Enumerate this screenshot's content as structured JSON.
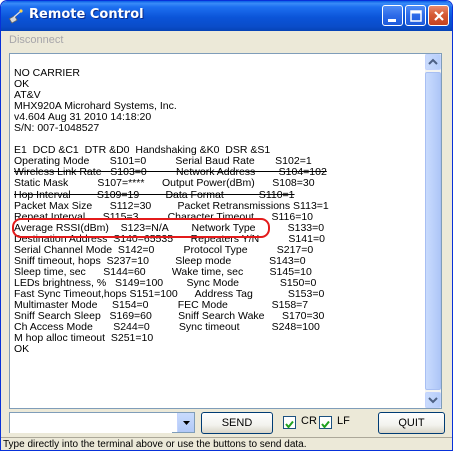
{
  "window": {
    "title": "Remote Control"
  },
  "menu": {
    "disconnect": "Disconnect"
  },
  "terminal": {
    "lines": [
      "NO CARRIER",
      "OK",
      "AT&V",
      "MHX920A Microhard Systems, Inc.",
      "v4.604 Aug 31 2010 14:18:20",
      "S/N: 007-1048527",
      "",
      "E1  DCD &C1  DTR &D0  Handshaking &K0  DSR &S1",
      "Operating Mode       S101=0          Serial Baud Rate       S102=1",
      "Wireless Link Rate   S103=0          Network Address        S104=102",
      "Static Mask          S107=****      Output Power(dBm)      S108=30",
      "Hop Interval         S109=19         Data Format            S110=1",
      "Packet Max Size      S112=30         Packet Retransmissions S113=1",
      "Repeat Interval      S115=3          Character Timeout      S116=10",
      "Average RSSI(dBm)    S123=N/A        Network Type           S133=0",
      "Destination Address  S140=65535      Repeaters Y/N          S141=0",
      "Serial Channel Mode  S142=0          Protocol Type          S217=0",
      "Sniff timeout, hops  S237=10         Sleep mode             S143=0",
      "Sleep time, sec      S144=60         Wake time, sec         S145=10",
      "LEDs brightness, %   S149=100        Sync Mode              S150=0",
      "Fast Sync Timeout,hops S151=100      Address Tag            S153=0",
      "Multimaster Mode     S154=0          FEC Mode               S158=7",
      "Sniff Search Sleep   S169=60         Sniff Search Wake      S170=30",
      "Ch Access Mode       S244=0          Sync timeout           S248=100",
      "M hop alloc timeout  S251=10",
      "OK"
    ]
  },
  "controls": {
    "command_value": "",
    "send_label": "SEND",
    "cr_label": "CR",
    "lf_label": "LF",
    "cr_checked": true,
    "lf_checked": true,
    "quit_label": "QUIT"
  },
  "status": {
    "text": "Type directly into the terminal above or use the buttons to send data."
  },
  "colors": {
    "title_bar": "#0b54d8",
    "highlight": "#e31b1b",
    "window_bg": "#ece9d8"
  }
}
